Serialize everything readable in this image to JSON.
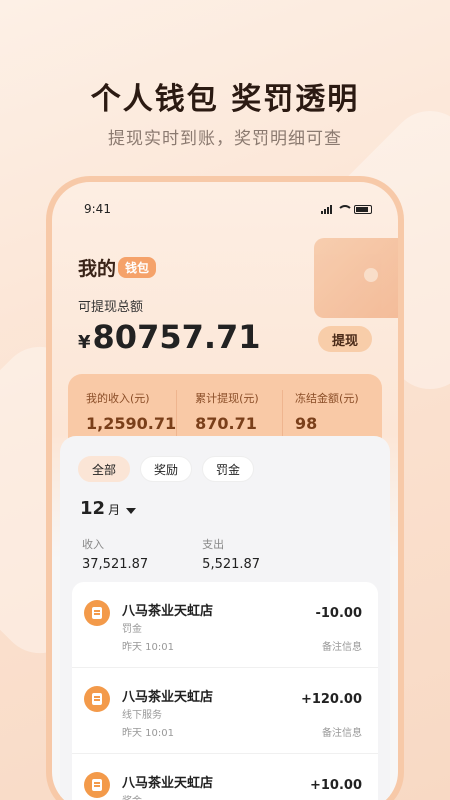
{
  "headline": "个人钱包  奖罚透明",
  "subline": "提现实时到账，奖罚明细可查",
  "status": {
    "time": "9:41"
  },
  "wallet": {
    "title": "我的",
    "title_pill": "钱包"
  },
  "balance": {
    "label": "可提现总额",
    "currency": "¥",
    "amount": "80757.71",
    "withdraw_label": "提现"
  },
  "stats": [
    {
      "label": "我的收入(元)",
      "value": "1,2590.71"
    },
    {
      "label": "累计提现(元)",
      "value": "870.71"
    },
    {
      "label": "冻结金额(元)",
      "value": "98"
    }
  ],
  "filters": [
    "全部",
    "奖励",
    "罚金"
  ],
  "month": {
    "number": "12",
    "unit": "月"
  },
  "summary": {
    "income_label": "收入",
    "income_value": "37,521.87",
    "expense_label": "支出",
    "expense_value": "5,521.87"
  },
  "transactions": [
    {
      "title": "八马茶业天虹店",
      "type": "罚金",
      "time": "昨天 10:01",
      "amount": "-10.00",
      "note": "备注信息"
    },
    {
      "title": "八马茶业天虹店",
      "type": "线下服务",
      "time": "昨天 10:01",
      "amount": "+120.00",
      "note": "备注信息"
    },
    {
      "title": "八马茶业天虹店",
      "type": "奖金",
      "time": "",
      "amount": "+10.00",
      "note": ""
    }
  ],
  "colors": {
    "accent": "#f39a4a",
    "pill": "#f5a26a",
    "stats_bg": "#f9c9a6"
  }
}
